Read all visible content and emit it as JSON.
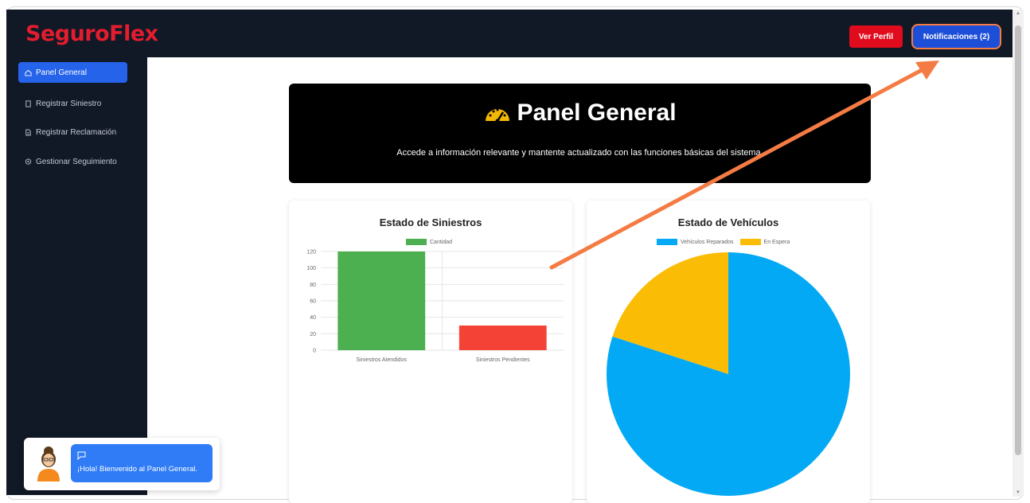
{
  "app": {
    "logo_part1": "Seguro",
    "logo_part2": "Flex"
  },
  "header": {
    "profile_button": "Ver Perfil",
    "notifications_button": "Notificaciones (2)"
  },
  "sidebar": {
    "items": [
      {
        "label": "Panel General",
        "icon": "home-icon",
        "active": true
      },
      {
        "label": "Registrar Siniestro",
        "icon": "document-icon",
        "active": false
      },
      {
        "label": "Registrar Reclamación",
        "icon": "file-text-icon",
        "active": false
      },
      {
        "label": "Gestionar Seguimiento",
        "icon": "location-pin-icon",
        "active": false
      }
    ]
  },
  "hero": {
    "title": "Panel General",
    "icon": "speedometer-icon",
    "subtitle": "Accede a información relevante y mantente actualizado con las funciones básicas del sistema."
  },
  "colors": {
    "topbar": "#111826",
    "accent_blue": "#2563eb",
    "brand_red": "#e11d2e",
    "arrow": "#f47c44",
    "bar_green": "#4caf50",
    "bar_red": "#f44336",
    "pie_blue": "#03a9f4",
    "pie_yellow": "#fbbc05"
  },
  "chart_data": [
    {
      "type": "bar",
      "title": "Estado de Siniestros",
      "categories": [
        "Siniestros Atendidos",
        "Siniestros Pendientes"
      ],
      "series": [
        {
          "name": "Cantidad",
          "values": [
            120,
            30
          ]
        }
      ],
      "bar_colors": [
        "#4caf50",
        "#f44336"
      ],
      "ylim": [
        0,
        120
      ],
      "yticks": [
        0,
        20,
        40,
        60,
        80,
        100,
        120
      ],
      "grid": true,
      "legend": "top-center"
    },
    {
      "type": "pie",
      "title": "Estado de Vehículos",
      "labels": [
        "Vehículos Reparados",
        "En Espera"
      ],
      "values": [
        80,
        20
      ],
      "colors": [
        "#03a9f4",
        "#fbbc05"
      ],
      "legend": "top-center"
    }
  ],
  "chat": {
    "message": "¡Hola! Bienvenido al Panel General.",
    "icon": "chat-bubble-icon",
    "avatar": "assistant-avatar"
  }
}
